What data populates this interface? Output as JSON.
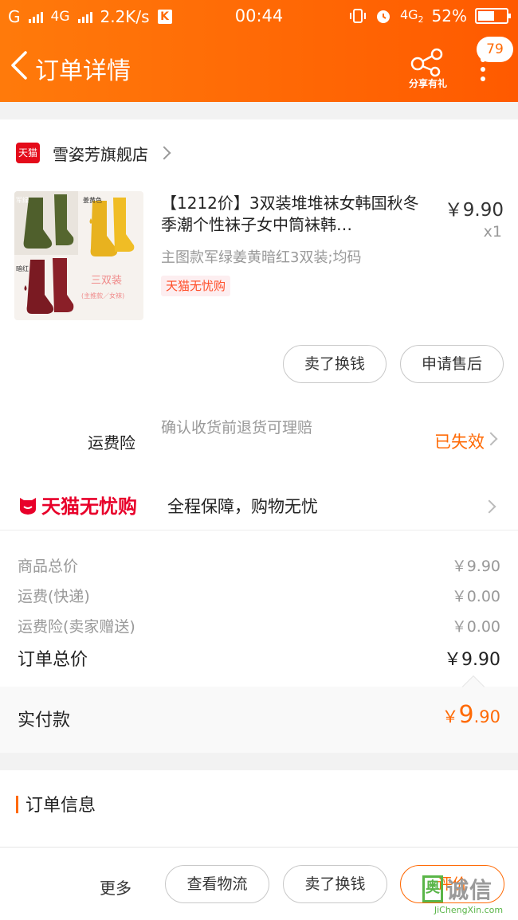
{
  "status_bar": {
    "carrier1": "G",
    "carrier2": "4G",
    "speed": "2.2K/s",
    "k_badge": "K",
    "time": "00:44",
    "network": "4G",
    "network_sub": "2",
    "battery": "52%"
  },
  "header": {
    "title": "订单详情",
    "share_label": "分享有礼",
    "message_count": "79"
  },
  "store": {
    "logo_text": "天猫",
    "name": "雪姿芳旗舰店"
  },
  "product": {
    "thumb_labels": [
      "军绿",
      "姜黄色",
      "暗红",
      "三双装",
      "(主推款／女袜)"
    ],
    "title": "【1212价】3双装堆堆袜女韩国秋冬季潮个性袜子女中筒袜韩…",
    "price": "￥9.90",
    "qty": "x1",
    "sku": "主图款军绿姜黄暗红3双装;均码",
    "tag": "天猫无忧购"
  },
  "actions": {
    "sell_label": "卖了换钱",
    "aftersale_label": "申请售后"
  },
  "insurance": {
    "label": "运费险",
    "desc": "确认收货前退货可理赔",
    "status": "已失效"
  },
  "wuyou": {
    "brand": "天猫无忧购",
    "slogan": "全程保障，购物无忧"
  },
  "fees": [
    {
      "label": "商品总价",
      "value": "￥9.90"
    },
    {
      "label": "运费(快递)",
      "value": "￥0.00"
    },
    {
      "label": "运费险(卖家赠送)",
      "value": "￥0.00"
    }
  ],
  "total": {
    "label": "订单总价",
    "value": "￥9.90"
  },
  "paid": {
    "label": "实付款",
    "currency": "￥",
    "integer": "9",
    "decimal": ".90"
  },
  "order_info": {
    "title": "订单信息"
  },
  "footer": {
    "more_label": "更多",
    "logistics_label": "查看物流",
    "sell_label": "卖了换钱",
    "review_label": "评价"
  },
  "watermark": {
    "square": "奥",
    "text": "诚信",
    "url": "JiChengXin.com"
  },
  "colors": {
    "brand_orange": "#ff6a05",
    "tmall_red": "#e40b1a",
    "text_grey": "#999999"
  }
}
